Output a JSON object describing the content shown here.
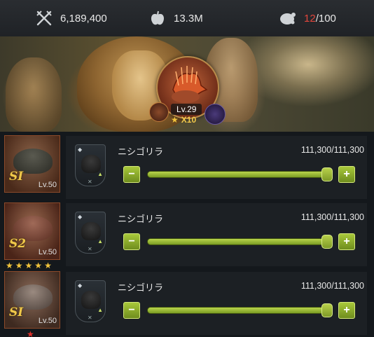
{
  "topbar": {
    "power": {
      "icon": "crossed-swords-icon",
      "value": "6,189,400"
    },
    "food": {
      "icon": "food-apple-icon",
      "value": "13.3M"
    },
    "capacity": {
      "icon": "meat-icon",
      "current": "12",
      "max": "/100"
    }
  },
  "banner": {
    "level": "Lv.29",
    "multiplier": "X10"
  },
  "rows": [
    {
      "badge": "SI",
      "level": "Lv.50",
      "stars": 0,
      "star_color": "",
      "unit_name": "ニシゴリラ",
      "count": "111,300/111,300",
      "fill": 1.0
    },
    {
      "badge": "S2",
      "level": "Lv.50",
      "stars": 5,
      "star_color": "#f2c43c",
      "unit_name": "ニシゴリラ",
      "count": "111,300/111,300",
      "fill": 1.0
    },
    {
      "badge": "SI",
      "level": "Lv.50",
      "stars": 1,
      "star_color": "#e0302a",
      "unit_name": "ニシゴリラ",
      "count": "111,300/111,300",
      "fill": 1.0
    }
  ],
  "colors": {
    "accent_green": "#8fb23a",
    "capacity_red": "#e2463c",
    "badge_gold": "#f0c84a"
  }
}
